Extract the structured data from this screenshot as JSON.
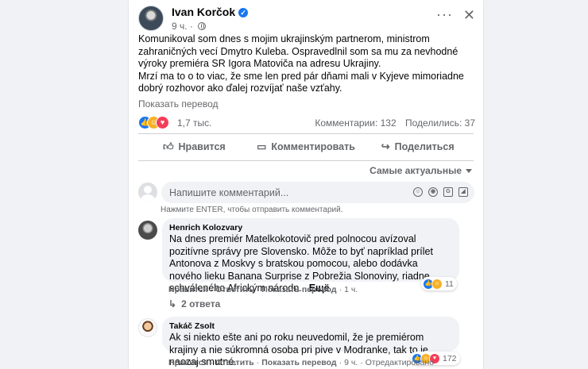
{
  "post": {
    "author": "Ivan Korčok",
    "time": "9 ч.",
    "more_icon": "more-icon",
    "close_icon": "close-icon",
    "paragraphs": [
      "Komunikoval som dnes s mojim ukrajinským partnerom, ministrom zahraničných vecí Dmytro Kuleba. Ospravedlnil som sa mu za nevhodné výroky premiéra SR Igora Matoviča na adresu Ukrajiny.",
      "Mrzí ma to o to viac, že sme len pred pár dňami mali v Kyjeve mimoriadne dobrý rozhovor ako ďalej rozvíjať naše vzťahy."
    ],
    "translate_label": "Показать перевод",
    "reactions_count": "1,7 тыс.",
    "comments_count": "Комментарии: 132",
    "shares_count": "Поделились: 37",
    "reaction_types": [
      "like",
      "care",
      "love"
    ]
  },
  "actions": {
    "like": "Нравится",
    "comment": "Комментировать",
    "share": "Поделиться"
  },
  "sort_label": "Самые актуальные",
  "comment_input": {
    "placeholder": "Напишите комментарий...",
    "hint": "Нажмите ENTER, чтобы отправить комментарий."
  },
  "comments": [
    {
      "name": "Henrich Kolozvary",
      "text": "Na dnes premiér Matelkokotovič pred polnocou avízoval pozitívne správy pre Slovensko. Môže to byť napríklad prílet Antonova z Moskvy s bratskou pomocou, alebo dodávka nového lieku Banana Surprise z Pobrežia Slonoviny, riadne schváleného Africkým národn...",
      "more": "Ещё",
      "like": "Нравится",
      "reply": "Ответить",
      "translate": "Показать перевод",
      "time": "1 ч.",
      "reactions": "11",
      "replies": "2 ответа"
    },
    {
      "name": "Takáč Zsolt",
      "text": "Ak si niekto ešte ani po roku neuvedomil, že je premiérom krajiny a nie súkromná osoba pri pive v Modranke, tak to je naozaj smutné.",
      "like": "Нравится",
      "reply": "Ответить",
      "translate": "Показать перевод",
      "time": "9 ч.",
      "edited": "Отредактировано",
      "reactions": "172"
    }
  ],
  "colors": {
    "accent": "#1877f2",
    "text": "#050505",
    "secondary": "#65676b",
    "bubble": "#f0f2f5"
  }
}
